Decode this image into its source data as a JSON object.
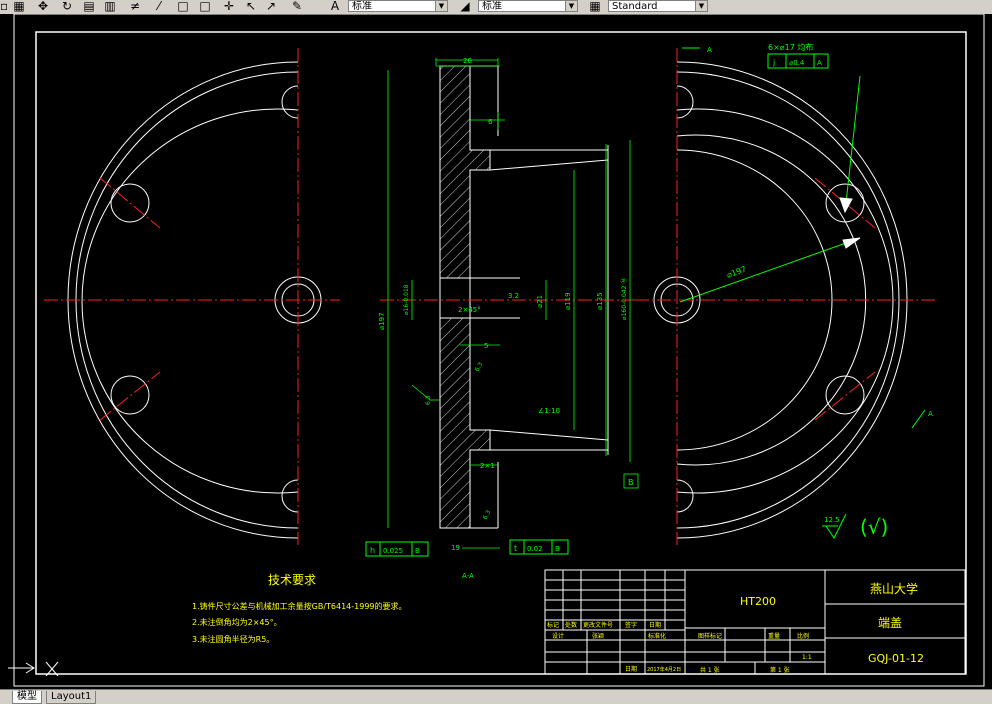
{
  "toolbar": {
    "icons": [
      "hatch-icon",
      "grid-icon",
      "pan-icon",
      "orbit-icon",
      "region-icon",
      "table-icon",
      "line-icon",
      "box-icon",
      "box2-icon",
      "move-icon",
      "cursor-icon",
      "paint-icon"
    ],
    "text_style": {
      "value": "标准"
    },
    "dim_style": {
      "value": "标准"
    },
    "table_style": {
      "value": "Standard"
    }
  },
  "tabs": {
    "model": "模型",
    "layout1": "Layout1"
  },
  "drawing": {
    "colors": {
      "geometry": "#ffffff",
      "dimension": "#00ff00",
      "centerline": "#ff2020",
      "annotation": "#ffff00"
    },
    "dims": {
      "d26": "26",
      "d6": "6",
      "d5": "5",
      "d197": "⌀197",
      "d119": "⌀119",
      "d135": "⌀135",
      "d160": "⌀160-0.042 Ⓜ",
      "d21": "⌀21",
      "d161": "⌀16-0.018",
      "chamfer1": "2×45°",
      "chamfer2": "2×1",
      "taper": "∠1:10",
      "r32": "3.2",
      "r63a": "6.3",
      "r63b": "6.3",
      "r63c": "6.3",
      "d19": "19",
      "radius197": "⌀197",
      "holes": "6×⌀17 均布",
      "section": "A-A",
      "letterA1": "A",
      "letterA2": "A",
      "datumB": "B"
    },
    "gdt": {
      "pos_sym": "j",
      "pos_tol": "⌀0.4",
      "pos_ref": "A",
      "flat_sym": "h",
      "flat_tol": "0.025",
      "flat_ref": "B",
      "run_sym": "t",
      "run_tol": "0.02",
      "run_ref": "B"
    },
    "roughness": {
      "value": "12.5",
      "text": "(√)"
    },
    "tech": {
      "title": "技术要求",
      "line1": "1.铸件尺寸公差与机械加工余量按GB/T6414-1999的要求。",
      "line2": "2.未注倒角均为2×45°。",
      "line3": "3.未注圆角半径为R5。"
    },
    "title_block": {
      "material": "HT200",
      "school": "燕山大学",
      "part": "端盖",
      "code": "GQJ-01-12",
      "hdr_mark": "标记",
      "hdr_count": "处数",
      "hdr_doc": "更改文件号",
      "hdr_sign": "签字",
      "hdr_date": "日期",
      "design": "设计",
      "designer": "张颖",
      "std": "标准化",
      "stage": "图样标记",
      "weight": "重量",
      "scale": "比例",
      "scale_val": "1:1",
      "approve": "日期",
      "date": "2017年4月2日",
      "total": "共 1 张",
      "sheet": "第 1 张"
    }
  }
}
